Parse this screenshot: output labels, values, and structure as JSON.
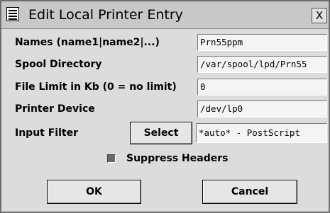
{
  "window": {
    "title": "Edit Local Printer Entry",
    "menu_icon": "window-menu-icon",
    "close_glyph": "X"
  },
  "fields": [
    {
      "label": "Names (name1|name2|...)",
      "value": "Prn55ppm"
    },
    {
      "label": "Spool Directory",
      "value": "/var/spool/lpd/Prn55"
    },
    {
      "label": "File Limit in Kb (0 = no limit)",
      "value": "0"
    },
    {
      "label": "Printer Device",
      "value": "/dev/lp0"
    }
  ],
  "input_filter": {
    "label": "Input Filter",
    "button_label": "Select",
    "value": "*auto* - PostScript"
  },
  "suppress_headers": {
    "label": "Suppress Headers",
    "checked": true
  },
  "buttons": {
    "ok": "OK",
    "cancel": "Cancel"
  }
}
